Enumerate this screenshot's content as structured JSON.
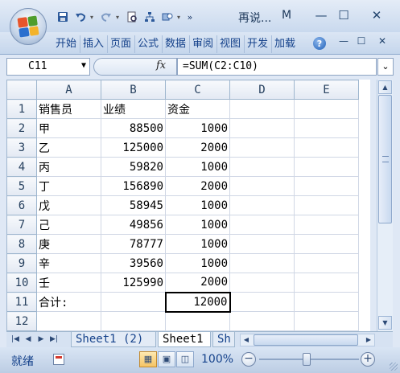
{
  "window": {
    "title": "再说...",
    "title_suffix": "M",
    "minimize": "—",
    "maximize": "☐",
    "close": "✕"
  },
  "quick_access": {
    "save_icon": "save-icon",
    "undo_icon": "undo-icon",
    "redo_icon": "redo-icon",
    "more": "»"
  },
  "ribbon": {
    "tabs": [
      "开始",
      "插入",
      "页面",
      "公式",
      "数据",
      "审阅",
      "视图",
      "开发",
      "加载"
    ],
    "help": "?"
  },
  "formula_bar": {
    "name_box": "C11",
    "fx": "fx",
    "formula": "=SUM(C2:C10)",
    "expand": "⌄"
  },
  "sheet": {
    "columns": [
      "A",
      "B",
      "C",
      "D",
      "E"
    ],
    "rows": [
      {
        "num": "1",
        "a": "销售员",
        "b": "业绩",
        "c": "资金"
      },
      {
        "num": "2",
        "a": "甲",
        "b": "88500",
        "c": "1000"
      },
      {
        "num": "3",
        "a": "乙",
        "b": "125000",
        "c": "2000"
      },
      {
        "num": "4",
        "a": "丙",
        "b": "59820",
        "c": "1000"
      },
      {
        "num": "5",
        "a": "丁",
        "b": "156890",
        "c": "2000"
      },
      {
        "num": "6",
        "a": "戊",
        "b": "58945",
        "c": "1000"
      },
      {
        "num": "7",
        "a": "己",
        "b": "49856",
        "c": "1000"
      },
      {
        "num": "8",
        "a": "庚",
        "b": "78777",
        "c": "1000"
      },
      {
        "num": "9",
        "a": "辛",
        "b": "39560",
        "c": "1000"
      },
      {
        "num": "10",
        "a": "壬",
        "b": "125990",
        "c": "2000"
      },
      {
        "num": "11",
        "a": "合计:",
        "b": "",
        "c": "12000"
      },
      {
        "num": "12",
        "a": "",
        "b": "",
        "c": ""
      }
    ],
    "active_cell": "C11"
  },
  "sheet_tabs": [
    "Sheet1 (2)",
    "Sheet1",
    "Sh"
  ],
  "status": {
    "ready": "就绪",
    "zoom": "100%",
    "zoom_minus": "−",
    "zoom_plus": "+"
  },
  "colors": {
    "accent": "#15428b",
    "header_active": "#f5c465",
    "office_logo": [
      "#e8552b",
      "#4f9d2d",
      "#2b6fce",
      "#f3b32b"
    ]
  }
}
